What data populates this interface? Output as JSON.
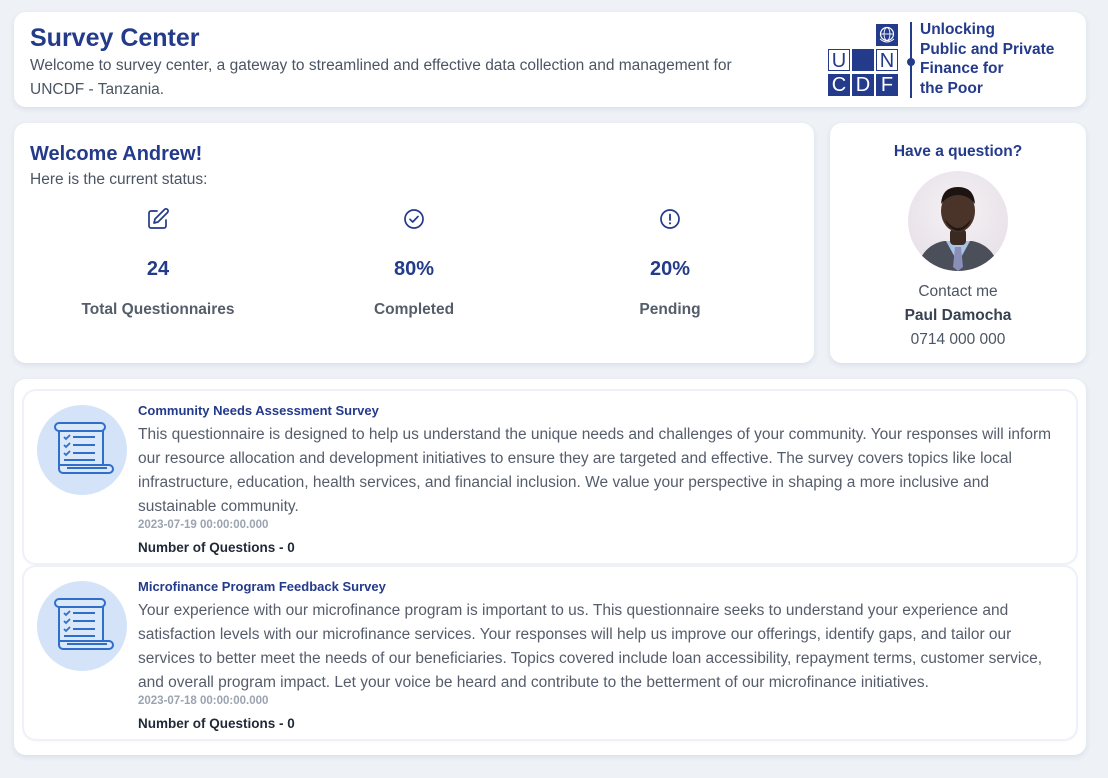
{
  "header": {
    "title": "Survey Center",
    "subtitle": "Welcome to survey center, a gateway to streamlined and effective data collection and management for UNCDF - Tanzania.",
    "logo": {
      "letters_top": [
        "U",
        "N"
      ],
      "letters_bottom": [
        "C",
        "D",
        "F"
      ],
      "tagline_lines": [
        "Unlocking",
        "Public and Private",
        "Finance for",
        "the Poor"
      ],
      "brand_color": "#243a8b"
    }
  },
  "welcome": {
    "greeting": "Welcome Andrew!",
    "status_caption": "Here is the current status:",
    "stats": [
      {
        "icon": "edit-icon",
        "value": "24",
        "label": "Total Questionnaires"
      },
      {
        "icon": "check-circle-icon",
        "value": "80%",
        "label": "Completed"
      },
      {
        "icon": "alert-circle-icon",
        "value": "20%",
        "label": "Pending"
      }
    ]
  },
  "contact": {
    "heading": "Have a question?",
    "caption": "Contact me",
    "name": "Paul Damocha",
    "phone": "0714 000 000"
  },
  "surveys": [
    {
      "title": "Community Needs Assessment Survey",
      "description": "This questionnaire is designed to help us understand the unique needs and challenges of your community. Your responses will inform our resource allocation and development initiatives to ensure they are targeted and effective. The survey covers topics like local infrastructure, education, health services, and financial inclusion. We value your perspective in shaping a more inclusive and sustainable community.",
      "date": "2023-07-19 00:00:00.000",
      "questions": "Number of Questions - 0"
    },
    {
      "title": "Microfinance Program Feedback Survey",
      "description": "Your experience with our microfinance program is important to us. This questionnaire seeks to understand your experience and satisfaction levels with our microfinance services. Your responses will help us improve our offerings, identify gaps, and tailor our services to better meet the needs of our beneficiaries. Topics covered include loan accessibility, repayment terms, customer service, and overall program impact. Let your voice be heard and contribute to the betterment of our microfinance initiatives.",
      "date": "2023-07-18 00:00:00.000",
      "questions": "Number of Questions - 0"
    }
  ],
  "colors": {
    "accent": "#243a8b",
    "background": "#eef2f7",
    "icon_circle": "#d4e3f8"
  }
}
